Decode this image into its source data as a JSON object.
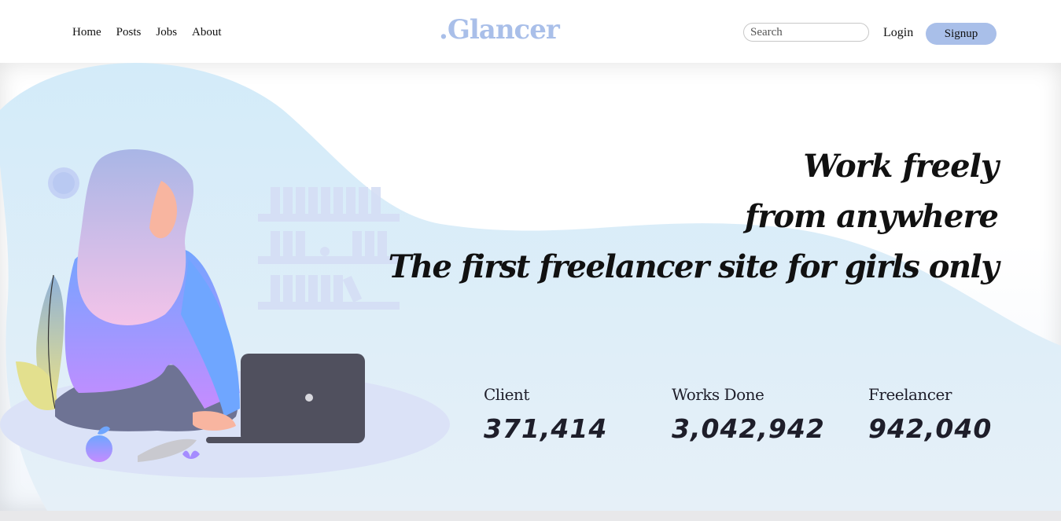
{
  "nav": {
    "items": [
      {
        "label": "Home"
      },
      {
        "label": "Posts"
      },
      {
        "label": "Jobs"
      },
      {
        "label": "About"
      }
    ]
  },
  "brand": {
    "logo": ".Glancer",
    "color": "#a9bfe9"
  },
  "search": {
    "placeholder": "Search",
    "value": ""
  },
  "auth": {
    "login_label": "Login",
    "signup_label": "Signup"
  },
  "hero": {
    "headline_line1": "Work freely",
    "headline_line2": "from anywhere",
    "headline_line3": "The first freelancer site for girls only",
    "illustration_icon": "woman-with-laptop-illustration"
  },
  "stats": [
    {
      "label": "Client",
      "value": "371,414"
    },
    {
      "label": "Works Done",
      "value": "3,042,942"
    },
    {
      "label": "Freelancer",
      "value": "942,040"
    }
  ],
  "colors": {
    "accent": "#a9bfe9",
    "blob": "#d6ebf8",
    "text": "#111111"
  }
}
